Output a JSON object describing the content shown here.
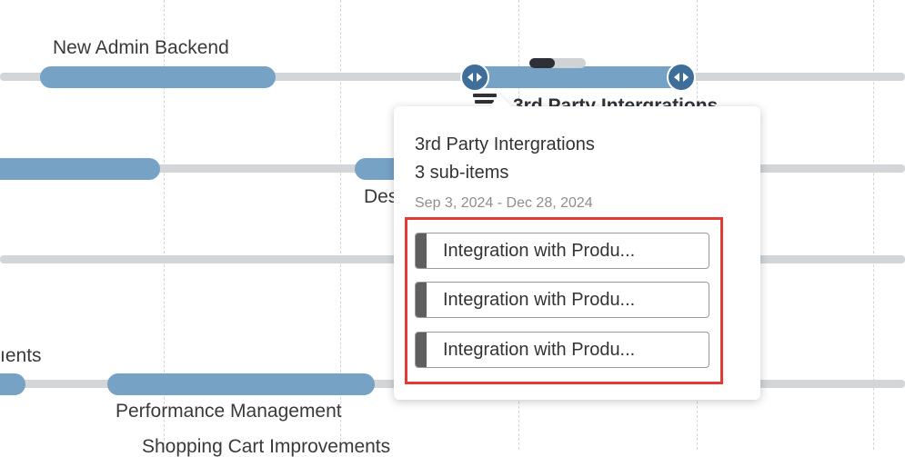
{
  "timeline": {
    "bars": [
      {
        "label": "New Admin Backend"
      },
      {
        "label": "3rd Party Intergrations"
      },
      {
        "label": "Des"
      },
      {
        "label": "ıents"
      },
      {
        "label": "Performance Management"
      },
      {
        "label": "Shopping Cart Improvements"
      }
    ],
    "selected_progress": 0.45
  },
  "tooltip": {
    "title": "3rd Party Intergrations",
    "sub_count": "3 sub-items",
    "date_range": "Sep 3, 2024 - Dec 28, 2024",
    "subitems": [
      {
        "label": "Integration with Produ..."
      },
      {
        "label": "Integration with Produ..."
      },
      {
        "label": "Integration with Produ..."
      }
    ]
  },
  "colors": {
    "bar": "#76a2c6",
    "handle": "#3f6e9b",
    "track": "#d3d6d9",
    "highlight": "#e53935",
    "progress_fill": "#2d3136"
  },
  "icons": {
    "handle": "resize-arrows-icon",
    "item_type": "document-stack-icon"
  }
}
